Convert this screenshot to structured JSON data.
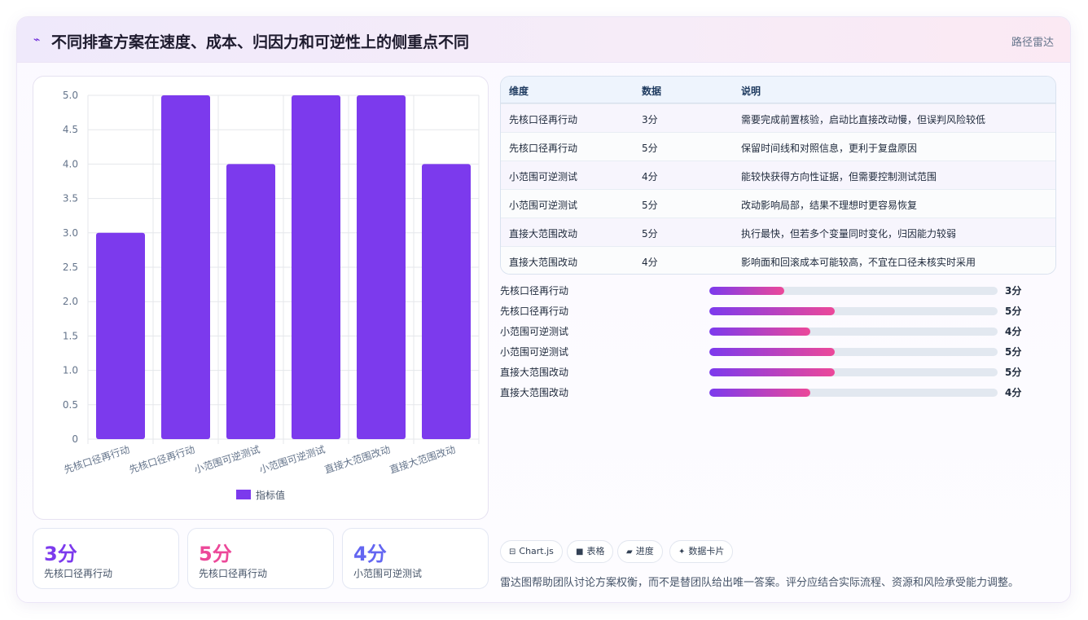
{
  "header": {
    "icon": "sparkle-icon",
    "title": "不同排查方案在速度、成本、归因力和可逆性上的侧重点不同",
    "tag": "路径雷达"
  },
  "colors": {
    "bar": "#7c3aed",
    "gradient_start": "#7c3aed",
    "gradient_end": "#ec4899",
    "stat_1": "#7c3aed",
    "stat_2": "#ec4899",
    "stat_3": "#6366f1"
  },
  "chart_data": {
    "type": "bar",
    "categories": [
      "先核口径再行动",
      "先核口径再行动",
      "小范围可逆测试",
      "小范围可逆测试",
      "直接大范围改动",
      "直接大范围改动"
    ],
    "series": [
      {
        "name": "指标值",
        "values": [
          3,
          5,
          4,
          5,
          5,
          4
        ]
      }
    ],
    "y_ticks": [
      "0",
      "0.5",
      "1.0",
      "1.5",
      "2.0",
      "2.5",
      "3.0",
      "3.5",
      "4.0",
      "4.5",
      "5.0"
    ],
    "ylim": [
      0,
      5
    ],
    "grid": true,
    "legend": "bottom"
  },
  "stats": [
    {
      "value": "3分",
      "label": "先核口径再行动"
    },
    {
      "value": "5分",
      "label": "先核口径再行动"
    },
    {
      "value": "4分",
      "label": "小范围可逆测试"
    }
  ],
  "table": {
    "headers": [
      "维度",
      "数据",
      "说明"
    ],
    "rows": [
      [
        "先核口径再行动",
        "3分",
        "需要完成前置核验，启动比直接改动慢，但误判风险较低"
      ],
      [
        "先核口径再行动",
        "5分",
        "保留时间线和对照信息，更利于复盘原因"
      ],
      [
        "小范围可逆测试",
        "4分",
        "能较快获得方向性证据，但需要控制测试范围"
      ],
      [
        "小范围可逆测试",
        "5分",
        "改动影响局部，结果不理想时更容易恢复"
      ],
      [
        "直接大范围改动",
        "5分",
        "执行最快，但若多个变量同时变化，归因能力较弱"
      ],
      [
        "直接大范围改动",
        "4分",
        "影响面和回滚成本可能较高，不宜在口径未核实时采用"
      ]
    ]
  },
  "progress": [
    {
      "label": "先核口径再行动",
      "value": "3分",
      "fraction": 0.26
    },
    {
      "label": "先核口径再行动",
      "value": "5分",
      "fraction": 0.435
    },
    {
      "label": "小范围可逆测试",
      "value": "4分",
      "fraction": 0.35
    },
    {
      "label": "小范围可逆测试",
      "value": "5分",
      "fraction": 0.435
    },
    {
      "label": "直接大范围改动",
      "value": "5分",
      "fraction": 0.435
    },
    {
      "label": "直接大范围改动",
      "value": "4分",
      "fraction": 0.35
    }
  ],
  "chips": [
    {
      "icon": "chart-icon",
      "glyph": "⊟",
      "label": "Chart.js"
    },
    {
      "icon": "table-icon",
      "glyph": "■",
      "label": "表格"
    },
    {
      "icon": "progress-icon",
      "glyph": "▰",
      "label": "进度"
    },
    {
      "icon": "card-icon",
      "glyph": "✦",
      "label": "数据卡片"
    }
  ],
  "note": "雷达图帮助团队讨论方案权衡，而不是替团队给出唯一答案。评分应结合实际流程、资源和风险承受能力调整。"
}
